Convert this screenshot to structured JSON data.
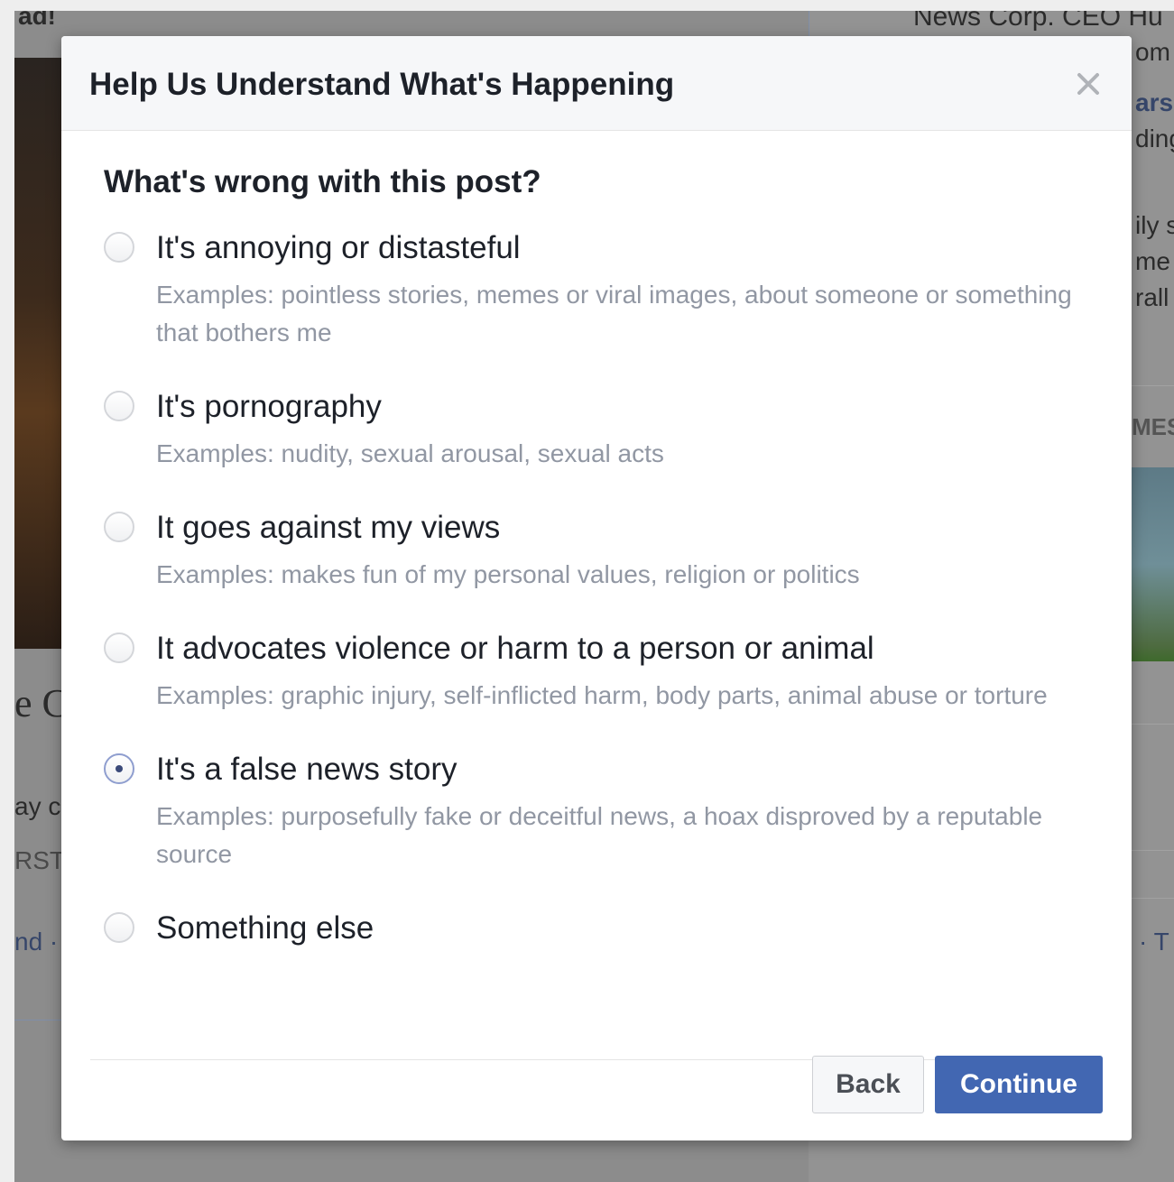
{
  "background": {
    "top_left_text": "ad!",
    "top_right_text": "News Corp. CEO Hu",
    "right_fragments": [
      "om",
      "ars",
      "ding",
      "ily s",
      "me",
      "rall",
      "MES"
    ],
    "left_fragments": [
      "e C",
      "ay c",
      "RST",
      "nd ·"
    ],
    "right_bottom_fragment": "· T"
  },
  "dialog": {
    "title": "Help Us Understand What's Happening",
    "question": "What's wrong with this post?",
    "options": [
      {
        "label": "It's annoying or distasteful",
        "description": "Examples: pointless stories, memes or viral images, about someone or something that bothers me",
        "checked": false
      },
      {
        "label": "It's pornography",
        "description": "Examples: nudity, sexual arousal, sexual acts",
        "checked": false
      },
      {
        "label": "It goes against my views",
        "description": "Examples: makes fun of my personal values, religion or politics",
        "checked": false
      },
      {
        "label": "It advocates violence or harm to a person or animal",
        "description": "Examples: graphic injury, self-inflicted harm, body parts, animal abuse or torture",
        "checked": false
      },
      {
        "label": "It's a false news story",
        "description": "Examples: purposefully fake or deceitful news, a hoax disproved by a reputable source",
        "checked": true
      },
      {
        "label": "Something else",
        "description": "",
        "checked": false
      }
    ],
    "back_label": "Back",
    "continue_label": "Continue"
  },
  "icons": {
    "close": "close-icon",
    "radio": "radio-button"
  },
  "colors": {
    "accent": "#4267b2",
    "title": "#1d2129",
    "description": "#9197a3"
  }
}
